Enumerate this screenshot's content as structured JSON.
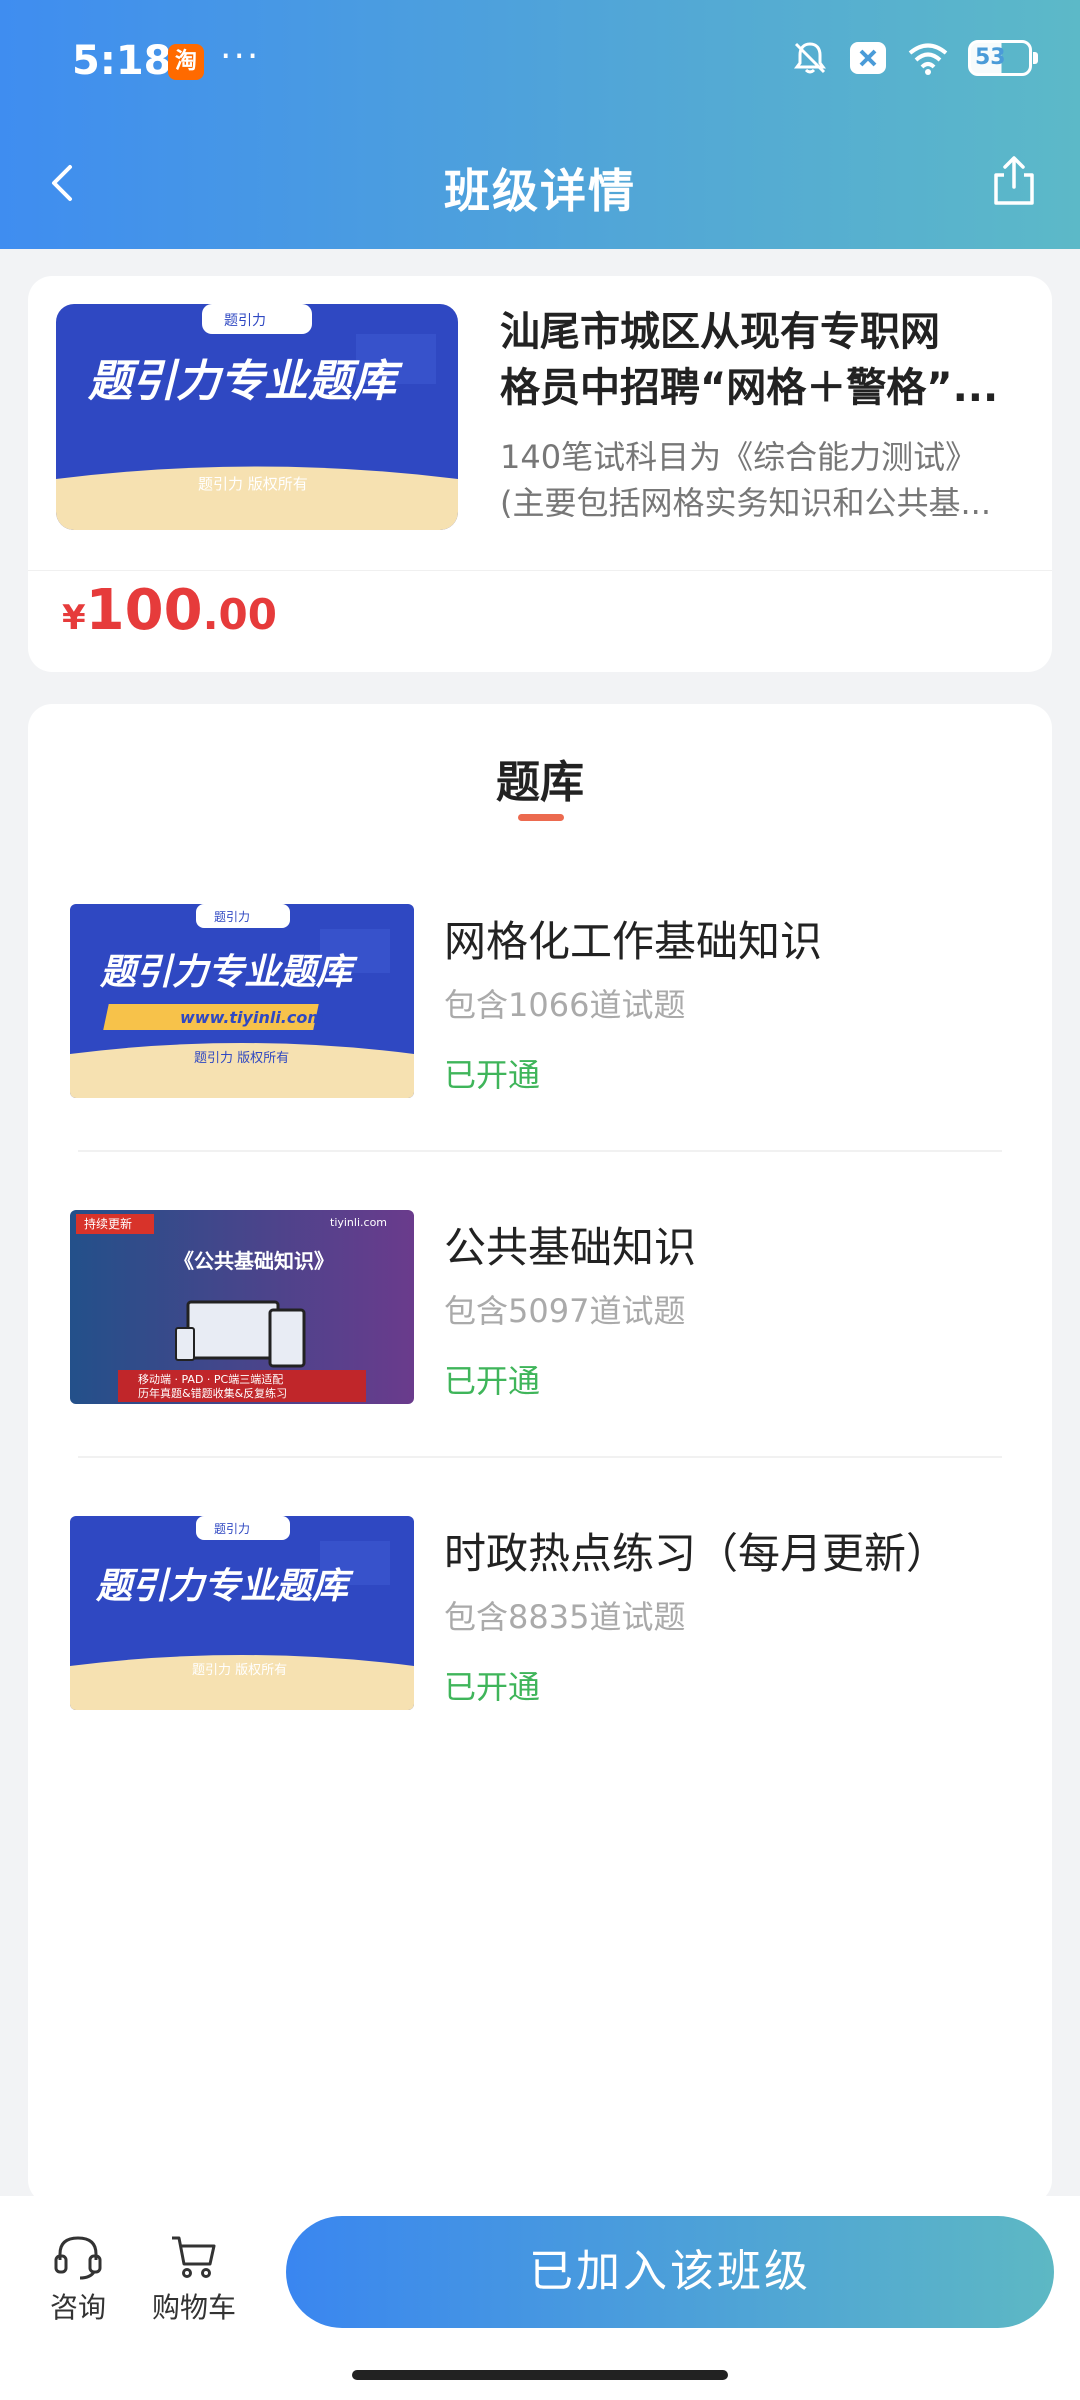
{
  "status_bar": {
    "time": "5:18",
    "app_badge": "淘",
    "dots": "···",
    "battery": "53"
  },
  "nav": {
    "title": "班级详情",
    "back_icon": "chevron-left-icon",
    "share_icon": "share-icon"
  },
  "class_info": {
    "title_line1": "汕尾市城区从现有专职网",
    "title_line2": "格员中招聘“网格＋警格”...",
    "desc_line1": "140笔试科目为《综合能力测试》",
    "desc_line2": "(主要包括网格实务知识和公共基...",
    "price_symbol": "¥",
    "price_int": "100",
    "price_dec": ".00",
    "thumb": {
      "logo": "题引力",
      "headline": "题引力专业题库",
      "footer": "题引力 版权所有"
    }
  },
  "question_bank": {
    "section_title": "题库",
    "items": [
      {
        "name": "网格化工作基础知识",
        "count": "包含1066道试题",
        "status": "已开通",
        "thumb_headline": "题引力专业题库",
        "thumb_url": "www.tiyinli.com",
        "thumb_footer": "题引力 版权所有",
        "thumb_logo": "题引力"
      },
      {
        "name": "公共基础知识",
        "count": "包含5097道试题",
        "status": "已开通",
        "thumb_badge": "持续更新",
        "thumb_brand": "tiyinli.com",
        "thumb_headline": "《公共基础知识》",
        "thumb_line1": "移动端 · PAD · PC端三端适配",
        "thumb_line2": "历年真题&错题收集&反复练习"
      },
      {
        "name": "时政热点练习（每月更新）",
        "count": "包含8835道试题",
        "status": "已开通",
        "thumb_headline": "题引力专业题库",
        "thumb_footer": "题引力 版权所有",
        "thumb_logo": "题引力"
      }
    ]
  },
  "bottom_bar": {
    "consult_label": "咨询",
    "cart_label": "购物车",
    "join_label": "已加入该班级"
  },
  "colors": {
    "header_start": "#3f8df0",
    "header_end": "#5cb9c8",
    "price": "#e63b3b",
    "status_ok": "#3fb55a",
    "underline": "#ec6a4f"
  }
}
